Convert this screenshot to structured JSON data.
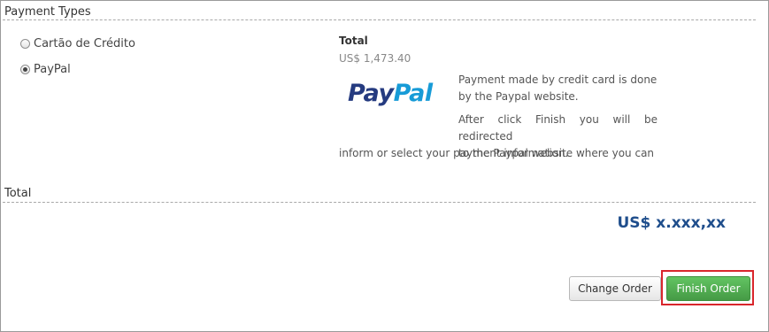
{
  "payment_section": {
    "title": "Payment Types",
    "options": [
      {
        "label": "Cartão de Crédito",
        "selected": false
      },
      {
        "label": "PayPal",
        "selected": true
      }
    ]
  },
  "summary": {
    "total_label": "Total",
    "total_value": "US$ 1,473.40"
  },
  "paypal": {
    "logo_pay": "Pay",
    "logo_pal": "Pal",
    "info_line1": "Payment made by credit card is done",
    "info_line2": "by the Paypal website.",
    "redirect_line1": "After click Finish you will be redirected",
    "redirect_line2": "to the Paypal website where you can",
    "redirect_line3": "inform or select your payment information."
  },
  "total_section": {
    "title": "Total",
    "amount": "US$ x.xxx,xx"
  },
  "actions": {
    "change_order": "Change Order",
    "finish_order": "Finish Order"
  },
  "colors": {
    "accent_blue": "#1f4e8c",
    "finish_green": "#4caf50",
    "highlight_red": "#d9262c",
    "paypal_dark": "#253b80",
    "paypal_light": "#179bd7"
  }
}
